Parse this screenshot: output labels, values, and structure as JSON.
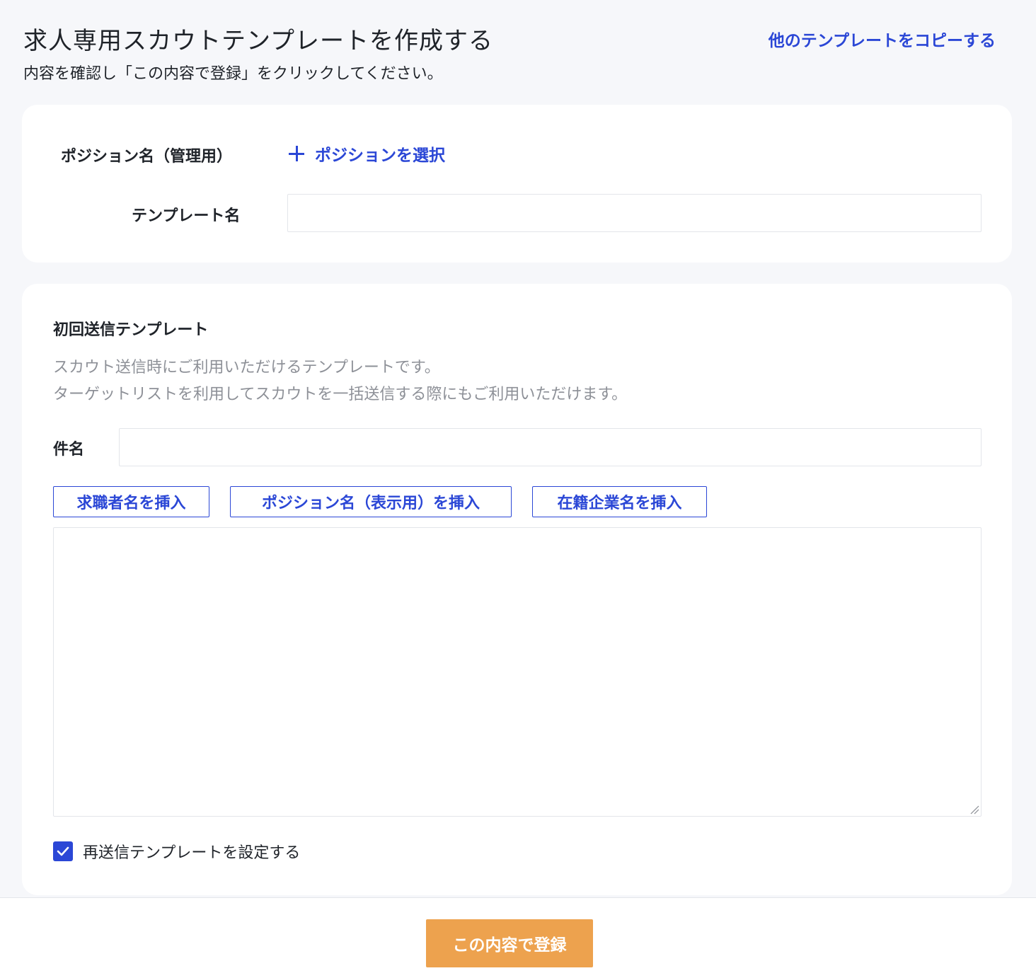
{
  "header": {
    "title": "求人専用スカウトテンプレートを作成する",
    "subtitle": "内容を確認し「この内容で登録」をクリックしてください。",
    "copy_link": "他のテンプレートをコピーする"
  },
  "position_card": {
    "position_label": "ポジション名（管理用）",
    "select_position": "ポジションを選択",
    "template_name_label": "テンプレート名",
    "template_name_value": ""
  },
  "first_send": {
    "title": "初回送信テンプレート",
    "description_line1": "スカウト送信時にご利用いただけるテンプレートです。",
    "description_line2": "ターゲットリストを利用してスカウトを一括送信する際にもご利用いただけます。",
    "subject_label": "件名",
    "subject_value": "",
    "insert_buttons": [
      "求職者名を挿入",
      "ポジション名（表示用）を挿入",
      "在籍企業名を挿入"
    ],
    "body_value": "",
    "resend_checkbox": {
      "label": "再送信テンプレートを設定する",
      "checked": true
    }
  },
  "footer": {
    "submit_label": "この内容で登録"
  },
  "colors": {
    "accent_blue": "#2b47d6",
    "submit_orange": "#eda24e",
    "background": "#f6f7fa",
    "muted_text": "#8d9097"
  }
}
